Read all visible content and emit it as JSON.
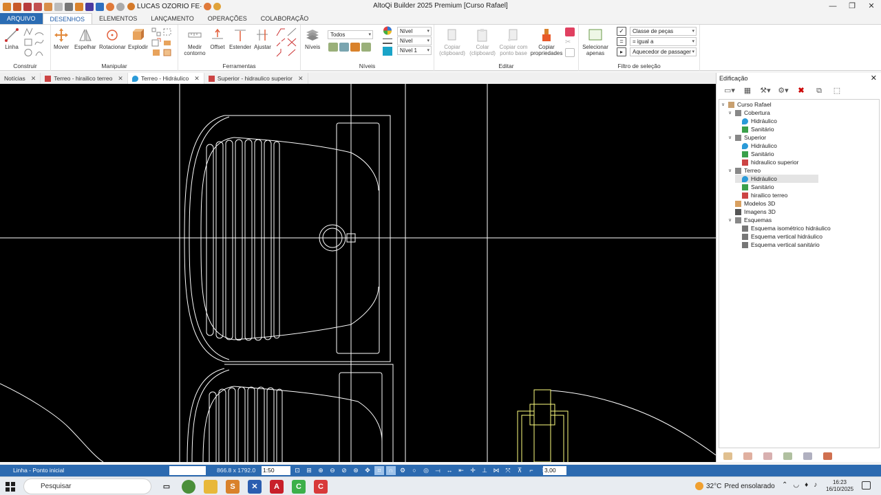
{
  "window": {
    "title": "AltoQi Builder 2025 Premium [Curso Rafael]",
    "user": "LUCAS OZORIO FE·",
    "controls": [
      "—",
      "❐",
      "✕"
    ]
  },
  "ribbon_tabs": [
    "ARQUIVO",
    "DESENHOS",
    "ELEMENTOS",
    "LANÇAMENTO",
    "OPERAÇÕES",
    "COLABORAÇÃO"
  ],
  "groups": {
    "construir": {
      "label": "Construir",
      "linha": "Linha"
    },
    "manipular": {
      "label": "Manipular",
      "mover": "Mover",
      "espelhar": "Espelhar",
      "rotacionar": "Rotacionar",
      "explodir": "Explodir"
    },
    "ferramentas": {
      "label": "Ferramentas",
      "medir": "Medir contorno",
      "offset": "Offset",
      "estender": "Estender",
      "ajustar": "Ajustar"
    },
    "niveis": {
      "label": "Níveis",
      "niveis_btn": "Níveis",
      "todos": "Todos",
      "nivel_a": "Nível",
      "nivel_b": "Nível",
      "nivel_c": "Nível 1"
    },
    "editar": {
      "label": "Editar",
      "copiar": "Copiar (clipboard)",
      "colar": "Colar (clipboard)",
      "copiar_base": "Copiar com ponto base",
      "copiar_prop": "Copiar propriedades"
    },
    "filtro": {
      "label": "Filtro de seleção",
      "selecionar": "Selecionar apenas",
      "classe": "Classe de peças",
      "igual": "= igual a",
      "aquecedor": "Aquecedor de passager"
    }
  },
  "doc_tabs": [
    "Notícias",
    "Terreo - hirailico terreo",
    "Terreo - Hidráulico",
    "Superior - hidraulico superior"
  ],
  "panel": {
    "title": "Edificação",
    "tree": [
      {
        "label": "Curso Rafael",
        "level": 0,
        "icon": "building"
      },
      {
        "label": "Cobertura",
        "level": 1,
        "icon": "floor"
      },
      {
        "label": "Hidráulico",
        "level": 2,
        "icon": "water"
      },
      {
        "label": "Sanitário",
        "level": 2,
        "icon": "pipe"
      },
      {
        "label": "Superior",
        "level": 1,
        "icon": "floor"
      },
      {
        "label": "Hidráulico",
        "level": 2,
        "icon": "water"
      },
      {
        "label": "Sanitário",
        "level": 2,
        "icon": "pipe"
      },
      {
        "label": "hidraulico superior",
        "level": 2,
        "icon": "drawing"
      },
      {
        "label": "Terreo",
        "level": 1,
        "icon": "floor"
      },
      {
        "label": "Hidráulico",
        "level": 2,
        "icon": "water",
        "selected": true
      },
      {
        "label": "Sanitário",
        "level": 2,
        "icon": "pipe"
      },
      {
        "label": "hirailico terreo",
        "level": 2,
        "icon": "drawing"
      },
      {
        "label": "Modelos 3D",
        "level": 1,
        "icon": "model"
      },
      {
        "label": "Imagens 3D",
        "level": 1,
        "icon": "camera"
      },
      {
        "label": "Esquemas",
        "level": 1,
        "icon": "floor"
      },
      {
        "label": "Esquema isométrico hidráulico",
        "level": 2,
        "icon": "schema"
      },
      {
        "label": "Esquema vertical hidráulico",
        "level": 2,
        "icon": "schema"
      },
      {
        "label": "Esquema vertical sanitário",
        "level": 2,
        "icon": "schema"
      }
    ]
  },
  "status": {
    "mode": "Linha - Ponto inicial",
    "coords": "866.8 x 1792.0",
    "scale": "1:50",
    "value": "3,00"
  },
  "taskbar": {
    "search": "Pesquisar",
    "temp": "32°C",
    "weather": "Pred ensolarado",
    "time": "16:23",
    "date": "16/10/2025"
  },
  "colors": {
    "accent": "#2b6cb3",
    "canvas": "#000000",
    "cad_line": "#ffffff",
    "cad_yellow": "#ffff80"
  }
}
